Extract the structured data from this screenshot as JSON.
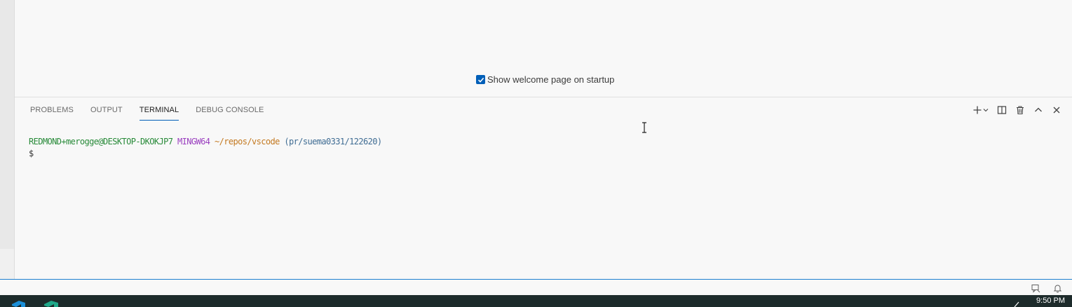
{
  "welcome": {
    "startup_checkbox_label": "Show welcome page on startup",
    "startup_checked": true
  },
  "panel": {
    "tabs": [
      {
        "label": "PROBLEMS",
        "active": false
      },
      {
        "label": "OUTPUT",
        "active": false
      },
      {
        "label": "TERMINAL",
        "active": true
      },
      {
        "label": "DEBUG CONSOLE",
        "active": false
      }
    ],
    "actions": [
      "add-terminal-icon",
      "chevron-down-icon",
      "split-icon",
      "trash-icon",
      "chevron-up-icon",
      "close-icon"
    ]
  },
  "terminal": {
    "user_host": "REDMOND+merogge@DESKTOP-DKOKJP7",
    "system": "MINGW64",
    "path": "~/repos/vscode",
    "branch": "(pr/suema0331/122620)",
    "prompt": "$"
  },
  "statusbar": {
    "icons": [
      "feedback-icon",
      "bell-icon"
    ]
  },
  "taskbar": {
    "clock": "9:50 PM"
  },
  "colors": {
    "accent": "#005fb8",
    "user": "#288a39",
    "system": "#9a3fbf",
    "path": "#c3781f",
    "branch": "#3f6c93"
  }
}
